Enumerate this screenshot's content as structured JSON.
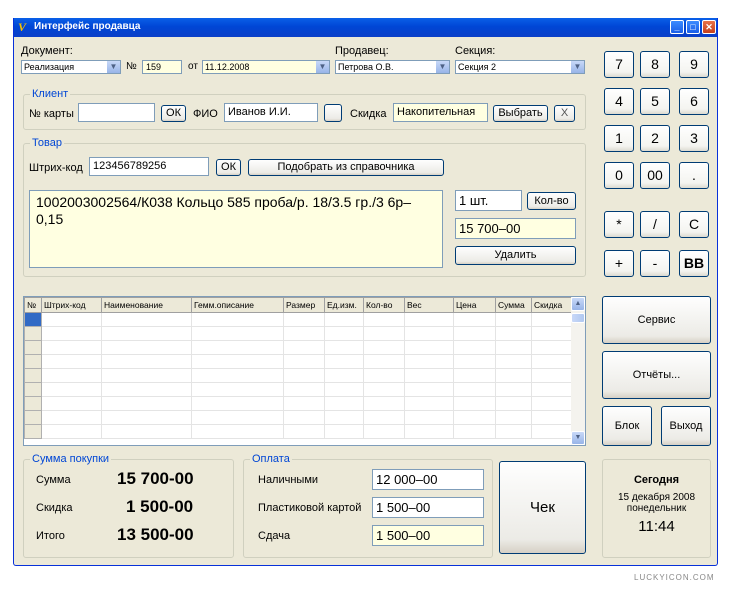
{
  "window": {
    "title": "Интерфейс продавца",
    "logo": "V",
    "min_icon": "minimize-icon",
    "max_icon": "maximize-icon",
    "close_icon": "close-icon"
  },
  "header": {
    "doc_label": "Документ:",
    "doc_value": "Реализация",
    "num_label": "№",
    "num_value": "159",
    "from_label": "от",
    "date_value": "11.12.2008",
    "seller_label": "Продавец:",
    "seller_value": "Петрова О.В.",
    "section_label": "Секция:",
    "section_value": "Секция 2"
  },
  "client": {
    "group": "Клиент",
    "card_label": "№ карты",
    "card_value": "",
    "ok": "ОК",
    "fio_label": "ФИО",
    "fio_value": "Иванов И.И.",
    "discount_label": "Скидка",
    "discount_value": "Накопительная",
    "choose": "Выбрать",
    "clear": "X"
  },
  "product": {
    "group": "Товар",
    "barcode_label": "Штрих-код",
    "barcode_value": "123456789256",
    "ok": "ОК",
    "lookup": "Подобрать из справочника",
    "description": "1002003002564/К038 Кольцо 585 проба/р. 18/3.5 гр./3 6р–0,15",
    "qty_value": "1 шт.",
    "qty_button": "Кол-во",
    "price_value": "15 700–00",
    "delete": "Удалить"
  },
  "grid": {
    "columns": [
      "№",
      "Штрих-код",
      "Наименование",
      "Гемм.описание",
      "Размер",
      "Ед.изм.",
      "Кол-во",
      "Вес",
      "Цена",
      "Сумма",
      "Скидка"
    ]
  },
  "keypad": [
    "7",
    "8",
    "9",
    "4",
    "5",
    "6",
    "1",
    "2",
    "3",
    "0",
    "00",
    ".",
    "*",
    "/",
    "C",
    "+",
    "-",
    "BB"
  ],
  "side": {
    "service": "Сервис",
    "reports": "Отчёты...",
    "block": "Блок",
    "exit": "Выход"
  },
  "totals": {
    "group": "Сумма покупки",
    "sum_label": "Сумма",
    "sum_value": "15 700-00",
    "disc_label": "Скидка",
    "disc_value": "1 500-00",
    "total_label": "Итого",
    "total_value": "13 500-00"
  },
  "payment": {
    "group": "Оплата",
    "cash_label": "Наличными",
    "cash_value": "12 000–00",
    "card_label": "Пластиковой картой",
    "card_value": "1 500–00",
    "change_label": "Сдача",
    "change_value": "1 500–00"
  },
  "check": "Чек",
  "today": {
    "title": "Сегодня",
    "date": "15 декабря 2008",
    "weekday": "понедельник",
    "time": "11:44"
  },
  "watermark": "LUCKYICON.COM"
}
